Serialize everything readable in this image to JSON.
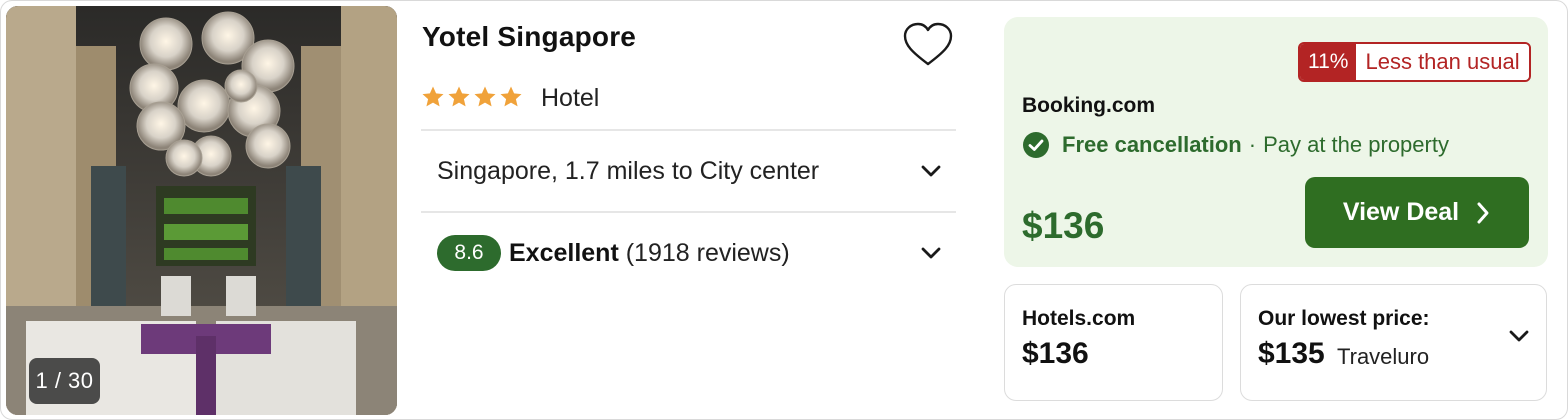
{
  "photo": {
    "counter": "1 / 30"
  },
  "hotel": {
    "name": "Yotel Singapore",
    "stars": 4,
    "type": "Hotel",
    "location": "Singapore, 1.7 miles to City center",
    "score": "8.6",
    "rating_label": "Excellent",
    "reviews": "(1918 reviews)"
  },
  "deal": {
    "discount_pct": "11%",
    "discount_label": "Less than usual",
    "provider": "Booking.com",
    "free_cancellation": "Free cancellation",
    "separator": "·",
    "payment": "Pay at the property",
    "price": "$136",
    "button_label": "View Deal"
  },
  "alt_offer": {
    "provider": "Hotels.com",
    "price": "$136"
  },
  "lowest": {
    "label": "Our lowest price:",
    "price": "$135",
    "provider": "Traveluro"
  },
  "colors": {
    "green": "#2d6b2d",
    "button_green": "#2f6e21",
    "deal_bg": "#edf6e8",
    "red": "#b32424",
    "star": "#f0a23a"
  },
  "icons": {
    "favorite": "heart-outline-icon",
    "expand": "chevron-down-icon",
    "check": "check-circle-icon",
    "next": "chevron-right-icon",
    "star": "star-icon"
  }
}
